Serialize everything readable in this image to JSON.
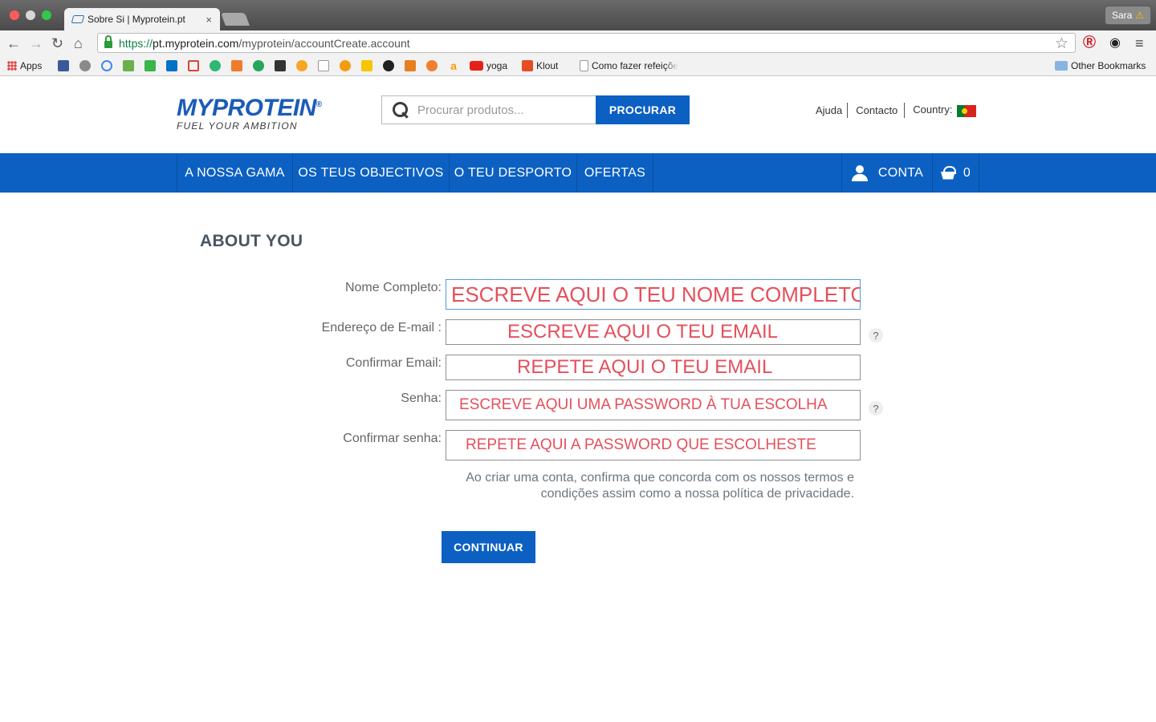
{
  "browser": {
    "tab_title": "Sobre Si | Myprotein.pt",
    "tab_close": "×",
    "profile_name": "Sara",
    "profile_warning": "⚠",
    "url_scheme": "https://",
    "url_host": "pt.myprotein.com",
    "url_path": "/myprotein/accountCreate.account",
    "bookmarks": {
      "apps": "Apps",
      "yoga": "yoga",
      "klout": "Klout",
      "como": "Como fazer refeiçõe",
      "other": "Other Bookmarks"
    }
  },
  "header": {
    "logo_main": "MYPROTEIN",
    "logo_reg": "®",
    "logo_tagline": "FUEL YOUR AMBITION",
    "search_placeholder": "Procurar produtos...",
    "search_button": "PROCURAR",
    "links": {
      "help": "Ajuda",
      "contact": "Contacto",
      "country": "Country:"
    }
  },
  "nav": {
    "items": [
      "A NOSSA GAMA",
      "OS TEUS OBJECTIVOS",
      "O TEU DESPORTO",
      "OFERTAS"
    ],
    "account": "CONTA",
    "basket_count": "0"
  },
  "form": {
    "title": "ABOUT YOU",
    "fields": [
      {
        "label": "Nome Completo:",
        "value": "ESCREVE AQUI O TEU NOME COMPLETO"
      },
      {
        "label": "Endereço de E-mail :",
        "value": "ESCREVE AQUI O TEU EMAIL",
        "help": "?"
      },
      {
        "label": "Confirmar Email:",
        "value": "REPETE AQUI O TEU EMAIL"
      },
      {
        "label": "Senha:",
        "value": "ESCREVE AQUI UMA PASSWORD À TUA ESCOLHA",
        "help": "?"
      },
      {
        "label": "Confirmar senha:",
        "value": "REPETE AQUI A PASSWORD QUE ESCOLHESTE"
      }
    ],
    "terms_line1": "Ao criar uma conta, confirma que concorda com os nossos termos e",
    "terms_line2": "condições assim como a nossa política de privacidade.",
    "continue_button": "CONTINUAR"
  }
}
